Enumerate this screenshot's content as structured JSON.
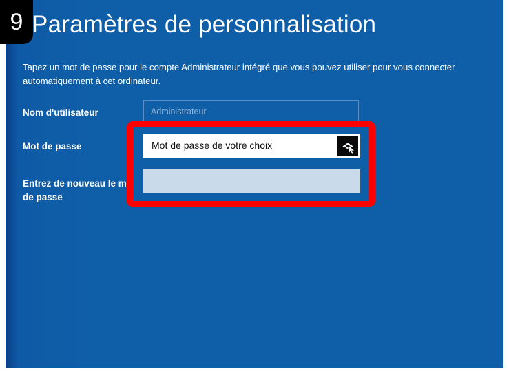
{
  "step_badge": "9",
  "title": "Paramètres de personnalisation",
  "instruction": "Tapez un mot de passe pour le compte Administrateur intégré que vous pouvez utiliser pour vous connecter automatiquement à cet ordinateur.",
  "form": {
    "username_label": "Nom d'utilisateur",
    "username_value": "Administrateur",
    "password_label": "Mot de passe",
    "password_value": "Mot de passe de votre choix",
    "repeat_label": "Entrez de nouveau le mot de passe",
    "repeat_value": ""
  },
  "icons": {
    "reveal": "eye-reveal-icon",
    "cursor": "mouse-pointer-icon"
  },
  "colors": {
    "background": "#0f5ea8",
    "highlight": "#ff0000",
    "badge": "#000000"
  }
}
